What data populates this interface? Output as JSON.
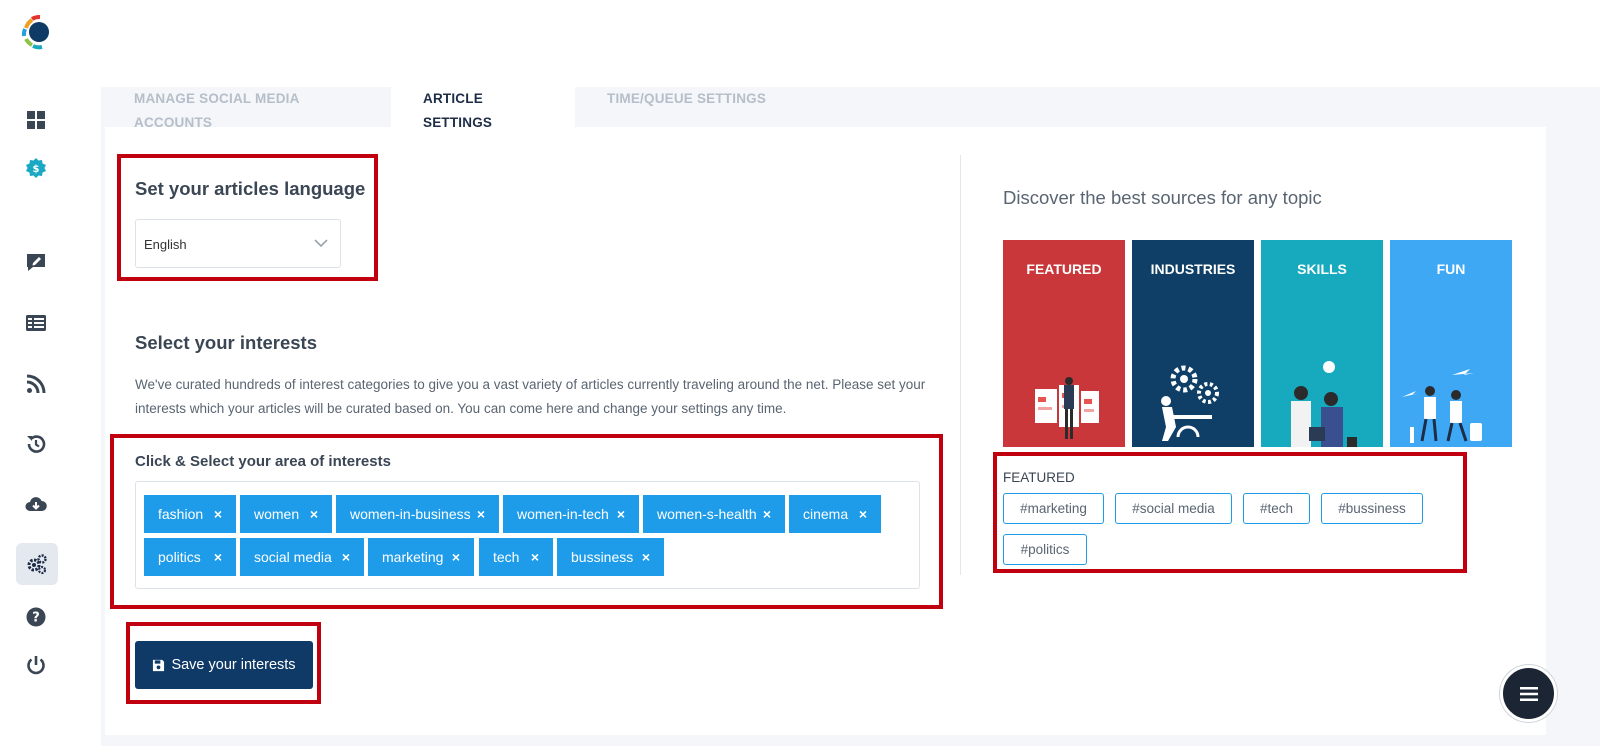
{
  "sidebar": {
    "logo": "app-logo",
    "items": [
      {
        "icon": "dashboard-icon"
      },
      {
        "icon": "dollar-badge-icon"
      },
      {
        "icon": "compose-icon"
      },
      {
        "icon": "articles-icon"
      },
      {
        "icon": "rss-icon"
      },
      {
        "icon": "history-icon"
      },
      {
        "icon": "cloud-download-icon"
      },
      {
        "icon": "settings-icon"
      },
      {
        "icon": "help-icon"
      },
      {
        "icon": "power-icon"
      }
    ]
  },
  "tabs": [
    {
      "label": "MANAGE SOCIAL MEDIA ACCOUNTS",
      "active": false
    },
    {
      "label": "ARTICLE SETTINGS",
      "active": true
    },
    {
      "label": "TIME/QUEUE SETTINGS",
      "active": false
    }
  ],
  "language": {
    "heading": "Set your articles language",
    "selected": "English"
  },
  "interests": {
    "heading": "Select your interests",
    "description": "We've curated hundreds of interest categories to give you a vast variety of articles currently traveling around the net. Please set your interests which your articles will be curated based on. You can come here and change your settings any time.",
    "select_heading": "Click & Select your area of interests",
    "remove_symbol": "×",
    "tags": [
      "fashion",
      "women",
      "women-in-business",
      "women-in-tech",
      "women-s-health",
      "cinema",
      "politics",
      "social media",
      "marketing",
      "tech",
      "bussiness"
    ]
  },
  "save_button": {
    "label": "Save your interests",
    "icon": "floppy-disk-icon"
  },
  "discover": {
    "heading": "Discover the best sources for any topic",
    "categories": [
      {
        "label": "FEATURED",
        "color": "#c9373a"
      },
      {
        "label": "INDUSTRIES",
        "color": "#0f3f66"
      },
      {
        "label": "SKILLS",
        "color": "#17aabf"
      },
      {
        "label": "FUN",
        "color": "#3fa8f5"
      }
    ],
    "featured_title": "FEATURED",
    "hashtags": [
      "#marketing",
      "#social media",
      "#tech",
      "#bussiness",
      "#politics"
    ]
  },
  "fab": {
    "icon": "menu-icon"
  },
  "colors": {
    "highlight": "#c0000f",
    "tag": "#1e9cea",
    "primary": "#0f3966"
  }
}
